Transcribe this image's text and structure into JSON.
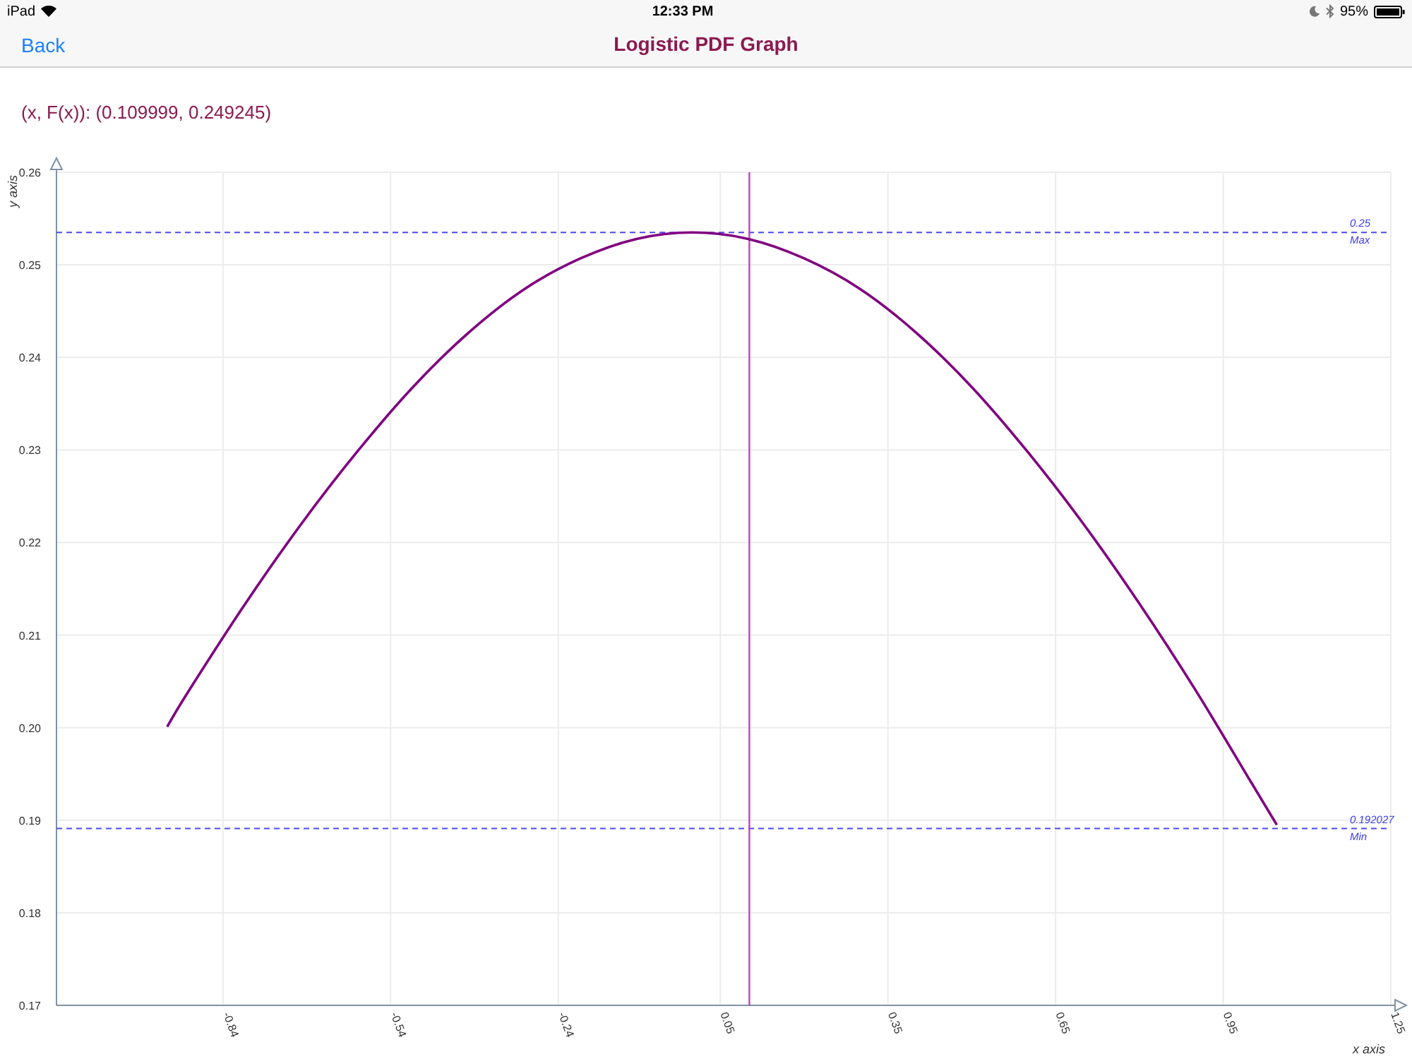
{
  "status_bar": {
    "device": "iPad",
    "time": "12:33 PM",
    "battery": "95%"
  },
  "nav": {
    "back": "Back",
    "title": "Logistic PDF Graph"
  },
  "readout": "(x, F(x)): (0.109999, 0.249245)",
  "chart": {
    "chart_data": {
      "type": "line",
      "xlabel": "x axis",
      "ylabel": "y axis",
      "xlim": [
        -1.138,
        1.25
      ],
      "grid": true,
      "ylim": [
        0.17,
        0.26
      ],
      "xticks": [
        {
          "value": -0.84,
          "label": "-0.84"
        },
        {
          "value": -0.54,
          "label": "-0.54"
        },
        {
          "value": -0.24,
          "label": "-0.24"
        },
        {
          "value": 0.05,
          "label": "0.05"
        },
        {
          "value": 0.35,
          "label": "0.35"
        },
        {
          "value": 0.65,
          "label": "0.65"
        },
        {
          "value": 0.95,
          "label": "0.95"
        },
        {
          "value": 1.25,
          "label": "1.25"
        }
      ],
      "yticks": [
        {
          "value": 0.17,
          "label": "0.17"
        },
        {
          "value": 0.18,
          "label": "0.18"
        },
        {
          "value": 0.19,
          "label": "0.19"
        },
        {
          "value": 0.2,
          "label": "0.20"
        },
        {
          "value": 0.21,
          "label": "0.21"
        },
        {
          "value": 0.22,
          "label": "0.22"
        },
        {
          "value": 0.23,
          "label": "0.23"
        },
        {
          "value": 0.24,
          "label": "0.24"
        },
        {
          "value": 0.25,
          "label": "0.25"
        },
        {
          "value": 0.26,
          "label": "0.26"
        }
      ],
      "x": [
        -0.94,
        -0.9,
        -0.8,
        -0.7,
        -0.6,
        -0.5,
        -0.4,
        -0.3,
        -0.2,
        -0.1,
        0,
        0.1,
        0.2,
        0.3,
        0.4,
        0.5,
        0.6,
        0.7,
        0.8,
        0.9,
        1.0,
        1.046
      ],
      "series": [
        {
          "color": "#800080",
          "values": [
            0.2001,
            0.2041,
            0.2134,
            0.222,
            0.2298,
            0.2368,
            0.2427,
            0.2474,
            0.2507,
            0.2528,
            0.2535,
            0.2528,
            0.2507,
            0.2474,
            0.2427,
            0.2368,
            0.2298,
            0.222,
            0.2134,
            0.2041,
            0.1941,
            0.1895
          ]
        }
      ],
      "ref_lines": [
        {
          "axis": "y",
          "value": 0.2535
        },
        {
          "axis": "y",
          "value": 0.1891
        },
        {
          "axis": "x",
          "value": 0.102
        }
      ]
    },
    "ref_labels": [
      {
        "value": "0.25",
        "name": "Max"
      },
      {
        "value": "0.192027",
        "name": "Min"
      }
    ]
  }
}
